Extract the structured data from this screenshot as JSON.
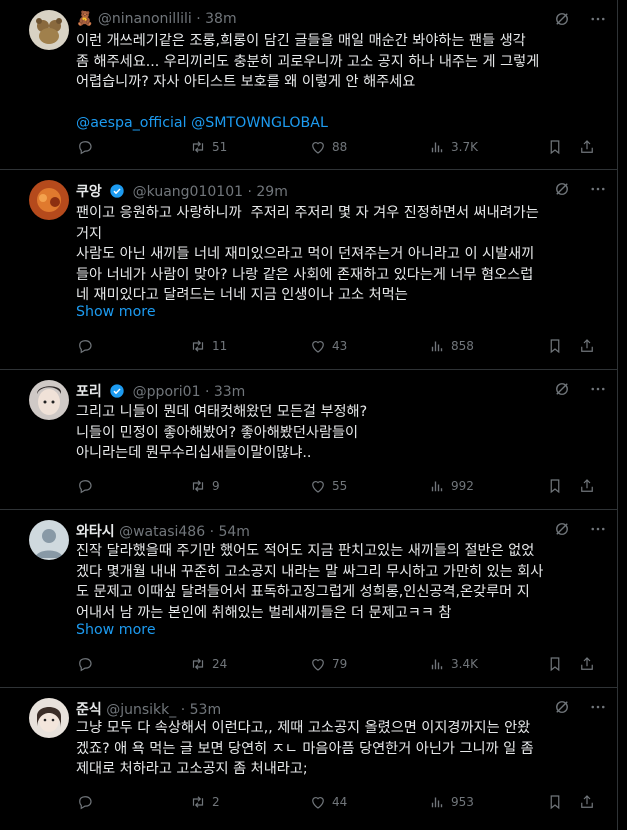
{
  "colors": {
    "background": "#000000",
    "text": "#e7e9ea",
    "muted": "#71767b",
    "link": "#1d9bf0",
    "verified": "#1d9bf0",
    "border": "#2f3336"
  },
  "tweets": [
    {
      "name": "",
      "emoji": "🧸",
      "handle": "@ninanonillili",
      "time": "38m",
      "lines": [
        "이런 개쓰레기같은 조롱,희롱이 담긴 글들을 매일 매순간 봐야하는 팬들 생각",
        "좀 해주세요... 우리끼리도 충분히 괴로우니까 고소 공지 하나 내주는 게 그렇게",
        "어렵습니까? 자사 아티스트 보호를 왜 이렇게 안 해주세요"
      ],
      "mentions": "@aespa_official @SMTOWNGLOBAL",
      "replies": "",
      "retweets": "51",
      "likes": "88",
      "views": "3.7K"
    },
    {
      "name": "쿠앙",
      "handle": "@kuang010101",
      "time": "29m",
      "lines": [
        "팬이고 응원하고 사랑하니까  주저리 주저리 몇 자 겨우 진정하면서 써내려가는",
        "거지",
        "사람도 아닌 새끼들 너네 재미있으라고 먹이 던져주는거 아니라고 이 시발새끼",
        "들아 너네가 사람이 맞아? 나랑 같은 사회에 존재하고 있다는게 너무 혐오스럽",
        "네 재미있다고 달려드는 너네 지금 인생이나 고소 처먹는"
      ],
      "show_more": "Show more",
      "replies": "",
      "retweets": "11",
      "likes": "43",
      "views": "858"
    },
    {
      "name": "포리",
      "handle": "@ppori01",
      "time": "33m",
      "lines": [
        "그리고 니들이 뭔데 여태컷해왔던 모든걸 부정해?",
        "니들이 민정이 좋아해봤어? 좋아해봤던사람들이",
        "아니라는데 뭔무수리십새들이말이많냐.."
      ],
      "replies": "",
      "retweets": "9",
      "likes": "55",
      "views": "992"
    },
    {
      "name": "와타시",
      "handle": "@watasi486",
      "time": "54m",
      "lines": [
        "진작 달라했을때 주기만 했어도 적어도 지금 판치고있는 새끼들의 절반은 없었",
        "겠다 몇개월 내내 꾸준히 고소공지 내라는 말 싸그리 무시하고 가만히 있는 회사",
        "도 문제고 이때싶 달려들어서 표독하고징그럽게 성희롱,인신공격,온갖루머 지",
        "어내서 남 까는 본인에 취해있는 벌레새끼들은 더 문제고ㅋㅋ 참"
      ],
      "show_more": "Show more",
      "replies": "",
      "retweets": "24",
      "likes": "79",
      "views": "3.4K"
    },
    {
      "name": "준식",
      "handle": "@junsikk_",
      "time": "53m",
      "lines": [
        "그냥 모두 다 속상해서 이런다고,, 제때 고소공지 올렸으면 이지경까지는 안왔",
        "겠죠? 애 욕 먹는 글 보면 당연히 ㅈㄴ 마음아픔 당연한거 아닌가 그니까 일 좀",
        "제대로 처하라고 고소공지 좀 처내라고;"
      ],
      "replies": "",
      "retweets": "2",
      "likes": "44",
      "views": "953"
    }
  ]
}
